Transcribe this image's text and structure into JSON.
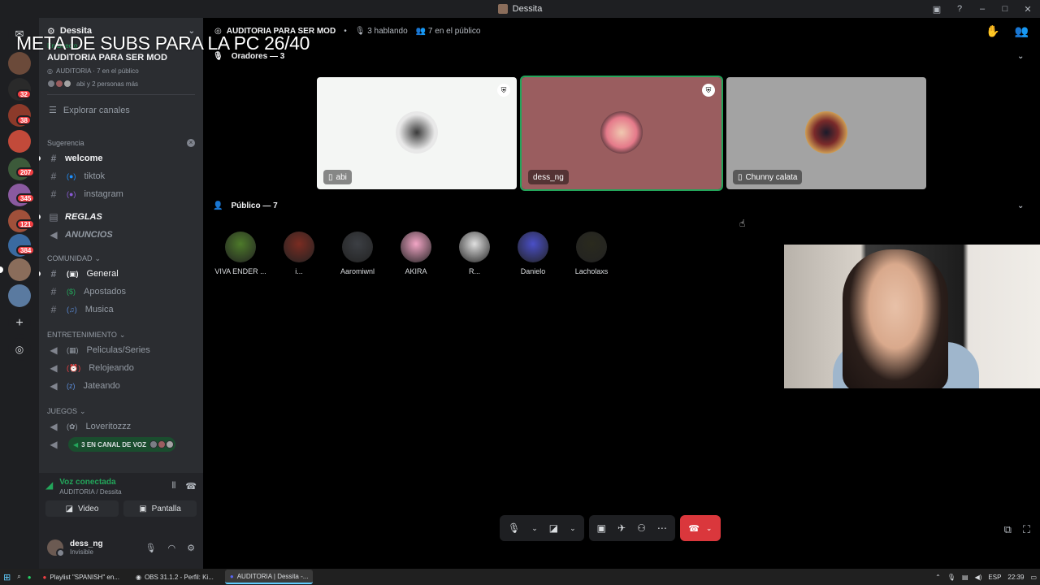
{
  "window": {
    "title": "Dessita",
    "right_icons": [
      "inbox-icon",
      "help-icon",
      "minimize-icon",
      "maximize-icon",
      "close-icon"
    ]
  },
  "overlay": {
    "text": "META DE SUBS PARA LA PC 26/40"
  },
  "rail": {
    "badges": [
      "32",
      "38",
      "207",
      "345",
      "121",
      "384"
    ]
  },
  "sidebar": {
    "server_name": "Dessita",
    "event": {
      "live_label": "En Directo",
      "title": "AUDITORIA PARA SER MOD",
      "sub": "AUDITORIA · 7 en el público",
      "people": "abi y 2 personas más"
    },
    "explore_label": "Explorar canales",
    "categories": {
      "suggestion": "Sugerencia",
      "community": "COMUNIDAD",
      "entertainment": "ENTRETENIMIENTO",
      "games": "JUEGOS"
    },
    "channels": {
      "welcome": "welcome",
      "tiktok": "tiktok",
      "instagram": "instagram",
      "reglas": "REGLAS",
      "anuncios": "ANUNCIOS",
      "general": "General",
      "apostados": "Apostados",
      "musica": "Musica",
      "peliculas": "Peliculas/Series",
      "relojeando": "Relojeando",
      "jateando": "Jateando",
      "loveritozzz": "Loveritozzz"
    },
    "voice_users_label": "3 EN CANAL DE VOZ"
  },
  "voice_panel": {
    "status": "Voz conectada",
    "location": "AUDITORIA / Dessita",
    "video_label": "Video",
    "screen_label": "Pantalla"
  },
  "user_panel": {
    "name": "dess_ng",
    "status": "Invisible"
  },
  "stage": {
    "name": "AUDITORIA PARA SER MOD",
    "speaking": "3 hablando",
    "audience": "7 en el público",
    "speakers_header": "Oradores — 3",
    "public_header": "Público — 7",
    "speakers": [
      {
        "name": "abi",
        "bg": "#f4f6f4",
        "mod": true,
        "mobile": true
      },
      {
        "name": "dess_ng",
        "bg": "#9a5d5f",
        "mod": true,
        "mobile": false
      },
      {
        "name": "Chunny calata",
        "bg": "#a3a3a3",
        "mod": false,
        "mobile": true
      }
    ],
    "public": [
      {
        "name": "VIVA ENDER ...",
        "color": "#4d7a2a"
      },
      {
        "name": "i...",
        "color": "#7a2c22"
      },
      {
        "name": "Aaromiwnl",
        "color": "#3c3f44"
      },
      {
        "name": "AKIRA",
        "color": "#f2a5c5"
      },
      {
        "name": "R...",
        "color": "#e0e0e0"
      },
      {
        "name": "Danielo",
        "color": "#4a4fc7"
      },
      {
        "name": "Lacholaxs",
        "color": "#2a2a1e"
      }
    ]
  },
  "taskbar": {
    "apps": [
      "Playlist \"SPANISH\" en...",
      "OBS 31.1.2 - Perfil: Ki...",
      "AUDITORIA | Dessita -..."
    ],
    "lang": "ESP",
    "time": "22:39"
  }
}
